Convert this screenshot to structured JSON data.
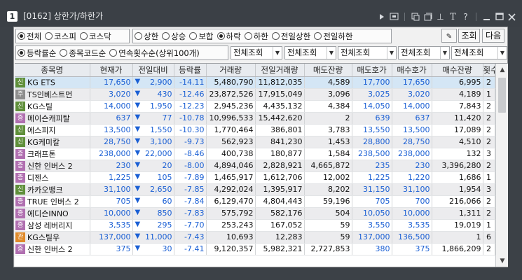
{
  "window": {
    "number": "1",
    "title": "[0162] 상한가/하한가",
    "icons": [
      "play-icon",
      "screen-icon",
      "copy-icon",
      "restore-icon",
      "pin-icon",
      "font-icon",
      "help-icon",
      "minimize-icon",
      "maximize-icon",
      "close-icon"
    ],
    "icon_glyphs": {
      "font": "T",
      "help": "?",
      "pin": "⊥"
    }
  },
  "filters": {
    "market": [
      {
        "label": "전체",
        "checked": true
      },
      {
        "label": "코스피",
        "checked": false
      },
      {
        "label": "코스닥",
        "checked": false
      }
    ],
    "type": [
      {
        "label": "상한",
        "checked": false
      },
      {
        "label": "상승",
        "checked": false
      },
      {
        "label": "보합",
        "checked": false
      },
      {
        "label": "하락",
        "checked": true
      },
      {
        "label": "하한",
        "checked": false
      },
      {
        "label": "전일상한",
        "checked": false
      },
      {
        "label": "전일하한",
        "checked": false
      }
    ],
    "sort": [
      {
        "label": "등락률순",
        "checked": true
      },
      {
        "label": "종목코드순",
        "checked": false
      },
      {
        "label": "연속횟수순(상위100개)",
        "checked": false
      }
    ],
    "selects": [
      "전체조회",
      "전체조회",
      "전체조회",
      "전체조회",
      "전체조회"
    ]
  },
  "buttons": {
    "query": "조회",
    "next": "다음"
  },
  "table": {
    "headers": [
      "종목명",
      "현재가",
      "전일대비",
      "등락률",
      "거래량",
      "전일거래량",
      "매도잔량",
      "매도호가",
      "매수호가",
      "매수잔량",
      "횟수"
    ],
    "rows": [
      {
        "badge": "신",
        "badge_color": "#5f8f3a",
        "name": "KG ETS",
        "price": "17,650",
        "change": "2,900",
        "rate": "-14.11",
        "volume": "5,480,790",
        "prev_volume": "11,812,035",
        "ask_qty": "4,589",
        "ask": "17,700",
        "bid": "17,650",
        "bid_qty": "6,995",
        "count": "2",
        "selected": true
      },
      {
        "badge": "주",
        "badge_color": "#8d8d8d",
        "name": "TS인베스트먼",
        "price": "3,020",
        "change": "430",
        "rate": "-12.46",
        "volume": "23,872,526",
        "prev_volume": "17,915,049",
        "ask_qty": "3,096",
        "ask": "3,025",
        "bid": "3,020",
        "bid_qty": "4,189",
        "count": "1"
      },
      {
        "badge": "신",
        "badge_color": "#5f8f3a",
        "name": "KG스틸",
        "price": "14,000",
        "change": "1,950",
        "rate": "-12.23",
        "volume": "2,945,236",
        "prev_volume": "4,435,132",
        "ask_qty": "4,384",
        "ask": "14,050",
        "bid": "14,000",
        "bid_qty": "7,843",
        "count": "2"
      },
      {
        "badge": "증",
        "badge_color": "#b06fb0",
        "name": "메이슨캐피탈",
        "price": "637",
        "change": "77",
        "rate": "-10.78",
        "volume": "10,996,533",
        "prev_volume": "15,442,620",
        "ask_qty": "2",
        "ask": "639",
        "bid": "637",
        "bid_qty": "11,420",
        "count": "2"
      },
      {
        "badge": "신",
        "badge_color": "#5f8f3a",
        "name": "에스피지",
        "price": "13,500",
        "change": "1,550",
        "rate": "-10.30",
        "volume": "1,770,464",
        "prev_volume": "386,801",
        "ask_qty": "3,783",
        "ask": "13,550",
        "bid": "13,500",
        "bid_qty": "17,089",
        "count": "2"
      },
      {
        "badge": "신",
        "badge_color": "#5f8f3a",
        "name": "KG케미칼",
        "price": "28,750",
        "change": "3,100",
        "rate": "-9.73",
        "volume": "562,923",
        "prev_volume": "841,230",
        "ask_qty": "1,453",
        "ask": "28,800",
        "bid": "28,750",
        "bid_qty": "4,510",
        "count": "2"
      },
      {
        "badge": "증",
        "badge_color": "#b06fb0",
        "name": "크래프톤",
        "price": "238,000",
        "change": "22,000",
        "rate": "-8.46",
        "volume": "400,738",
        "prev_volume": "180,877",
        "ask_qty": "1,584",
        "ask": "238,500",
        "bid": "238,000",
        "bid_qty": "132",
        "count": "3"
      },
      {
        "badge": "증",
        "badge_color": "#b06fb0",
        "name": "신한 인버스 2",
        "price": "230",
        "change": "20",
        "rate": "-8.00",
        "volume": "4,894,046",
        "prev_volume": "2,828,921",
        "ask_qty": "4,665,872",
        "ask": "235",
        "bid": "230",
        "bid_qty": "3,396,280",
        "count": "2"
      },
      {
        "badge": "증",
        "badge_color": "#b06fb0",
        "name": "디젠스",
        "price": "1,225",
        "change": "105",
        "rate": "-7.89",
        "volume": "1,465,917",
        "prev_volume": "1,612,706",
        "ask_qty": "12,002",
        "ask": "1,225",
        "bid": "1,220",
        "bid_qty": "1,686",
        "count": "1"
      },
      {
        "badge": "신",
        "badge_color": "#5f8f3a",
        "name": "카카오뱅크",
        "price": "31,100",
        "change": "2,650",
        "rate": "-7.85",
        "volume": "4,292,024",
        "prev_volume": "1,395,917",
        "ask_qty": "8,202",
        "ask": "31,150",
        "bid": "31,100",
        "bid_qty": "1,954",
        "count": "3"
      },
      {
        "badge": "증",
        "badge_color": "#b06fb0",
        "name": "TRUE 인버스 2",
        "price": "705",
        "change": "60",
        "rate": "-7.84",
        "volume": "6,129,470",
        "prev_volume": "4,804,443",
        "ask_qty": "59,196",
        "ask": "705",
        "bid": "700",
        "bid_qty": "216,066",
        "count": "2"
      },
      {
        "badge": "증",
        "badge_color": "#b06fb0",
        "name": "에디슨INNO",
        "price": "10,000",
        "change": "850",
        "rate": "-7.83",
        "volume": "575,792",
        "prev_volume": "582,176",
        "ask_qty": "504",
        "ask": "10,050",
        "bid": "10,000",
        "bid_qty": "1,311",
        "count": "2"
      },
      {
        "badge": "증",
        "badge_color": "#b06fb0",
        "name": "삼성 레버리지",
        "price": "3,535",
        "change": "295",
        "rate": "-7.70",
        "volume": "253,243",
        "prev_volume": "167,052",
        "ask_qty": "59",
        "ask": "3,550",
        "bid": "3,535",
        "bid_qty": "19,019",
        "count": "1"
      },
      {
        "badge": "관",
        "badge_color": "#e08a2a",
        "name": "KG스틸우",
        "price": "137,000",
        "change": "11,000",
        "rate": "-7.43",
        "volume": "10,693",
        "prev_volume": "12,283",
        "ask_qty": "59",
        "ask": "137,000",
        "bid": "136,500",
        "bid_qty": "1",
        "count": "6"
      },
      {
        "badge": "증",
        "badge_color": "#b06fb0",
        "name": "신한 인버스 2",
        "price": "375",
        "change": "30",
        "rate": "-7.41",
        "volume": "9,120,357",
        "prev_volume": "5,982,321",
        "ask_qty": "2,727,853",
        "ask": "380",
        "bid": "375",
        "bid_qty": "1,866,209",
        "count": "2"
      }
    ]
  },
  "colors": {
    "blue": "#1a5fd4",
    "selected_row": "#d4e6f5",
    "alt_row": "#ececee",
    "header": "#e8ebef"
  }
}
